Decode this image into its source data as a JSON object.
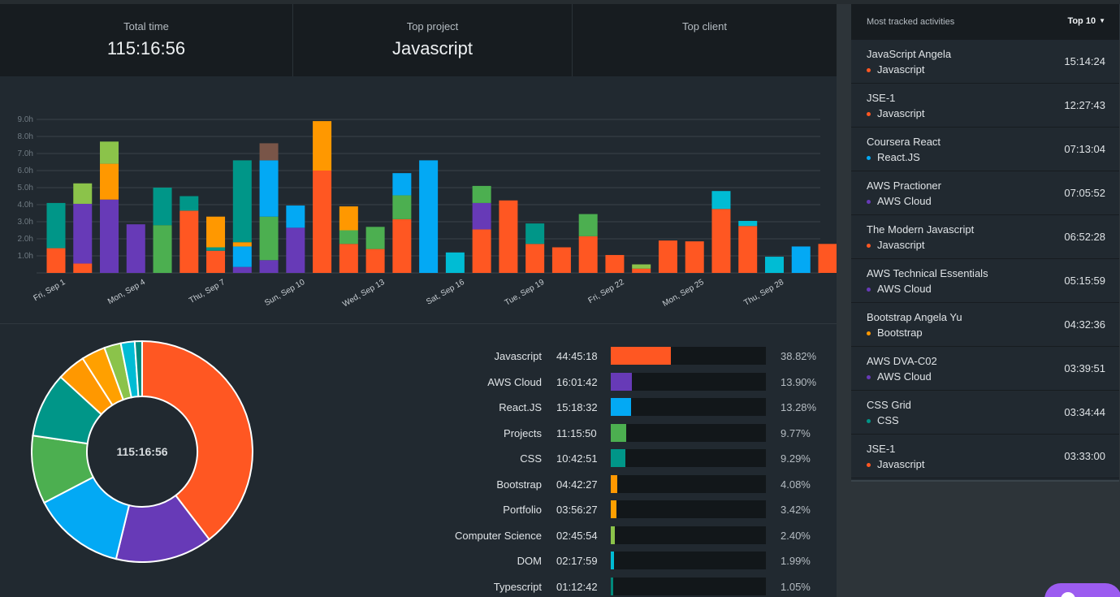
{
  "summary": {
    "total_time_label": "Total time",
    "total_time_value": "115:16:56",
    "top_project_label": "Top project",
    "top_project_value": "Javascript",
    "top_client_label": "Top client",
    "top_client_value": ""
  },
  "colors": {
    "Javascript": "#ff5722",
    "AWS Cloud": "#673ab7",
    "React.JS": "#03a9f4",
    "Projects": "#4caf50",
    "CSS": "#009688",
    "Bootstrap": "#ff9800",
    "Portfolio": "#ffa000",
    "Computer Science": "#8bc34a",
    "DOM": "#00bcd4",
    "Typescript": "#00897b",
    "Other": "#795548",
    "grid": "#3a434a",
    "axis_text": "#9aa3aa"
  },
  "chart_data": {
    "type": "bar",
    "stacked": true,
    "ylim": [
      0,
      9
    ],
    "y_ticks": [
      "1.0h",
      "2.0h",
      "3.0h",
      "4.0h",
      "5.0h",
      "6.0h",
      "7.0h",
      "8.0h",
      "9.0h"
    ],
    "y_tick_values": [
      1,
      2,
      3,
      4,
      5,
      6,
      7,
      8,
      9
    ],
    "x_labels": [
      "Fri, Sep 1",
      "Mon, Sep 4",
      "Thu, Sep 7",
      "Sun, Sep 10",
      "Wed, Sep 13",
      "Sat, Sep 16",
      "Tue, Sep 19",
      "Fri, Sep 22",
      "Mon, Sep 25",
      "Thu, Sep 28"
    ],
    "x_label_indices": [
      0,
      3,
      6,
      9,
      12,
      15,
      18,
      21,
      24,
      27
    ],
    "days": [
      [
        {
          "p": "Javascript",
          "v": 1.45
        },
        {
          "p": "CSS",
          "v": 2.65
        }
      ],
      [
        {
          "p": "Javascript",
          "v": 0.55
        },
        {
          "p": "AWS Cloud",
          "v": 3.5
        },
        {
          "p": "Computer Science",
          "v": 1.2
        }
      ],
      [
        {
          "p": "AWS Cloud",
          "v": 4.3
        },
        {
          "p": "Bootstrap",
          "v": 2.1
        },
        {
          "p": "Computer Science",
          "v": 1.3
        }
      ],
      [
        {
          "p": "AWS Cloud",
          "v": 2.85
        }
      ],
      [
        {
          "p": "Projects",
          "v": 2.8
        },
        {
          "p": "CSS",
          "v": 2.2
        }
      ],
      [
        {
          "p": "Javascript",
          "v": 3.65
        },
        {
          "p": "CSS",
          "v": 0.85
        }
      ],
      [
        {
          "p": "Javascript",
          "v": 1.3
        },
        {
          "p": "CSS",
          "v": 0.2
        },
        {
          "p": "Bootstrap",
          "v": 1.8
        }
      ],
      [
        {
          "p": "AWS Cloud",
          "v": 0.35
        },
        {
          "p": "React.JS",
          "v": 1.2
        },
        {
          "p": "Bootstrap",
          "v": 0.25
        },
        {
          "p": "CSS",
          "v": 4.8
        }
      ],
      [
        {
          "p": "AWS Cloud",
          "v": 0.75
        },
        {
          "p": "Projects",
          "v": 2.55
        },
        {
          "p": "React.JS",
          "v": 3.3
        },
        {
          "p": "Other",
          "v": 1.0
        }
      ],
      [
        {
          "p": "AWS Cloud",
          "v": 2.65
        },
        {
          "p": "React.JS",
          "v": 1.3
        }
      ],
      [
        {
          "p": "Javascript",
          "v": 6.0
        },
        {
          "p": "Bootstrap",
          "v": 2.9
        }
      ],
      [
        {
          "p": "Javascript",
          "v": 1.7
        },
        {
          "p": "Projects",
          "v": 0.8
        },
        {
          "p": "Bootstrap",
          "v": 1.4
        }
      ],
      [
        {
          "p": "Javascript",
          "v": 1.4
        },
        {
          "p": "Projects",
          "v": 1.3
        }
      ],
      [
        {
          "p": "Javascript",
          "v": 3.15
        },
        {
          "p": "Projects",
          "v": 1.4
        },
        {
          "p": "React.JS",
          "v": 1.3
        }
      ],
      [
        {
          "p": "React.JS",
          "v": 6.6
        }
      ],
      [
        {
          "p": "DOM",
          "v": 1.2
        }
      ],
      [
        {
          "p": "Javascript",
          "v": 2.55
        },
        {
          "p": "AWS Cloud",
          "v": 1.55
        },
        {
          "p": "Projects",
          "v": 1.0
        }
      ],
      [
        {
          "p": "Javascript",
          "v": 4.25
        }
      ],
      [
        {
          "p": "Javascript",
          "v": 1.7
        },
        {
          "p": "CSS",
          "v": 1.2
        }
      ],
      [
        {
          "p": "Javascript",
          "v": 1.5
        }
      ],
      [
        {
          "p": "Javascript",
          "v": 2.15
        },
        {
          "p": "Projects",
          "v": 1.3
        }
      ],
      [
        {
          "p": "Javascript",
          "v": 1.05
        }
      ],
      [
        {
          "p": "Javascript",
          "v": 0.25
        },
        {
          "p": "Computer Science",
          "v": 0.25
        }
      ],
      [
        {
          "p": "Javascript",
          "v": 1.9
        }
      ],
      [
        {
          "p": "Javascript",
          "v": 1.85
        }
      ],
      [
        {
          "p": "Javascript",
          "v": 3.75
        },
        {
          "p": "DOM",
          "v": 1.05
        }
      ],
      [
        {
          "p": "Javascript",
          "v": 2.75
        },
        {
          "p": "DOM",
          "v": 0.3
        }
      ],
      [
        {
          "p": "DOM",
          "v": 0.95
        }
      ],
      [
        {
          "p": "React.JS",
          "v": 1.55
        }
      ],
      [
        {
          "p": "Javascript",
          "v": 1.7
        }
      ]
    ]
  },
  "donut": {
    "center_label": "115:16:56"
  },
  "projects": [
    {
      "name": "Javascript",
      "time": "44:45:18",
      "pct": "38.82%",
      "value": 38.82
    },
    {
      "name": "AWS Cloud",
      "time": "16:01:42",
      "pct": "13.90%",
      "value": 13.9
    },
    {
      "name": "React.JS",
      "time": "15:18:32",
      "pct": "13.28%",
      "value": 13.28
    },
    {
      "name": "Projects",
      "time": "11:15:50",
      "pct": "9.77%",
      "value": 9.77
    },
    {
      "name": "CSS",
      "time": "10:42:51",
      "pct": "9.29%",
      "value": 9.29
    },
    {
      "name": "Bootstrap",
      "time": "04:42:27",
      "pct": "4.08%",
      "value": 4.08
    },
    {
      "name": "Portfolio",
      "time": "03:56:27",
      "pct": "3.42%",
      "value": 3.42
    },
    {
      "name": "Computer Science",
      "time": "02:45:54",
      "pct": "2.40%",
      "value": 2.4
    },
    {
      "name": "DOM",
      "time": "02:17:59",
      "pct": "1.99%",
      "value": 1.99
    },
    {
      "name": "Typescript",
      "time": "01:12:42",
      "pct": "1.05%",
      "value": 1.05
    }
  ],
  "activities_panel": {
    "title": "Most tracked activities",
    "filter_label": "Top 10",
    "items": [
      {
        "name": "JavaScript Angela",
        "project": "Javascript",
        "time": "15:14:24",
        "color": "#ff5722"
      },
      {
        "name": "JSE-1",
        "project": "Javascript",
        "time": "12:27:43",
        "color": "#ff5722"
      },
      {
        "name": "Coursera React",
        "project": "React.JS",
        "time": "07:13:04",
        "color": "#03a9f4"
      },
      {
        "name": "AWS Practioner",
        "project": "AWS Cloud",
        "time": "07:05:52",
        "color": "#673ab7"
      },
      {
        "name": "The Modern Javascript",
        "project": "Javascript",
        "time": "06:52:28",
        "color": "#ff5722"
      },
      {
        "name": "AWS Technical Essentials",
        "project": "AWS Cloud",
        "time": "05:15:59",
        "color": "#673ab7"
      },
      {
        "name": "Bootstrap Angela Yu",
        "project": "Bootstrap",
        "time": "04:32:36",
        "color": "#ff9800"
      },
      {
        "name": "AWS DVA-C02",
        "project": "AWS Cloud",
        "time": "03:39:51",
        "color": "#673ab7"
      },
      {
        "name": "CSS Grid",
        "project": "CSS",
        "time": "03:34:44",
        "color": "#009688"
      },
      {
        "name": "JSE-1",
        "project": "Javascript",
        "time": "03:33:00",
        "color": "#ff5722"
      }
    ]
  }
}
